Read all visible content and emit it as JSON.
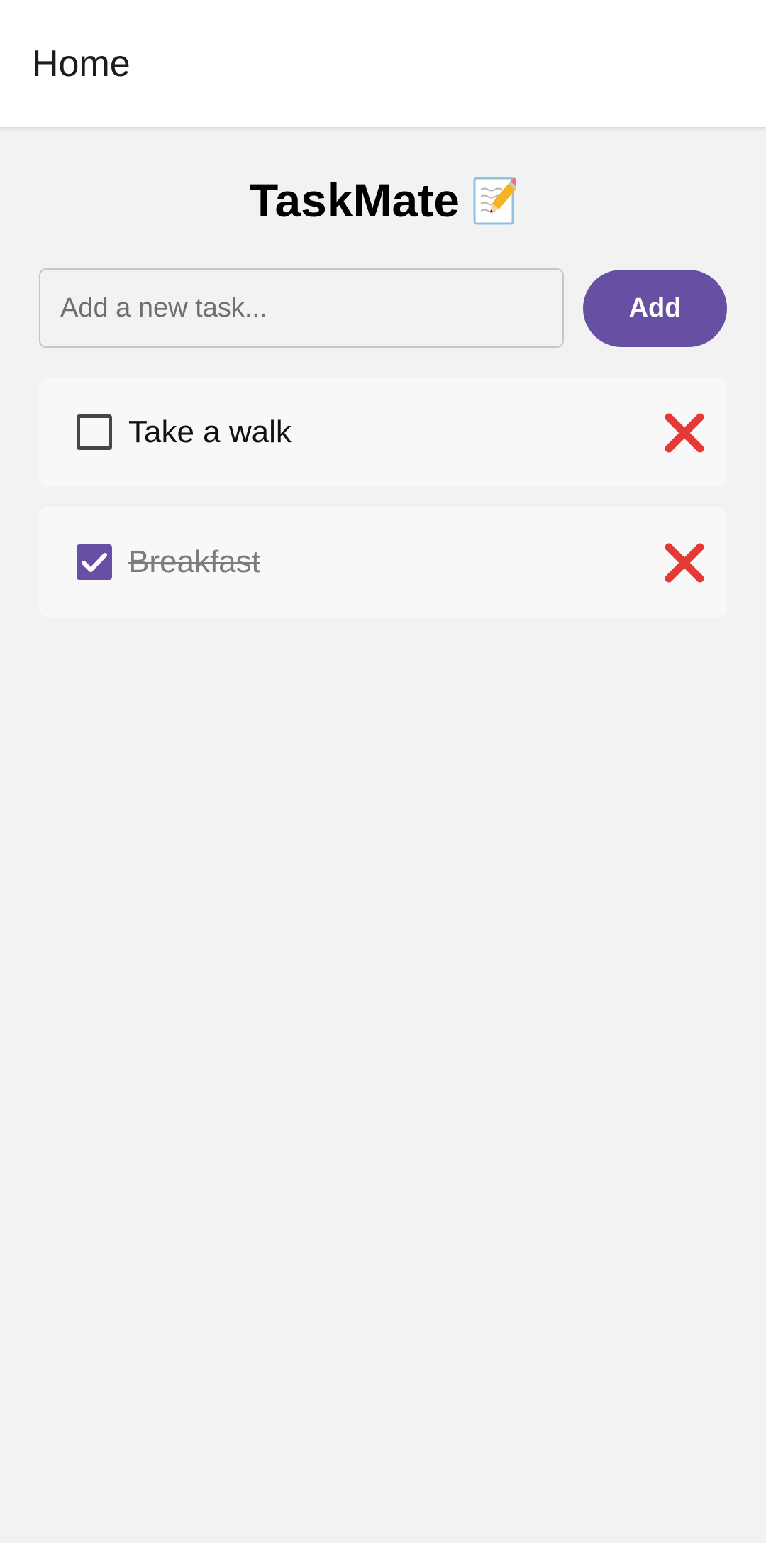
{
  "app_bar": {
    "title": "Home"
  },
  "page": {
    "title": "TaskMate",
    "title_icon": "memo-pencil-icon"
  },
  "new_task": {
    "placeholder": "Add a new task...",
    "value": "",
    "add_label": "Add"
  },
  "tasks": [
    {
      "label": "Take a walk",
      "done": false
    },
    {
      "label": "Breakfast",
      "done": true
    }
  ],
  "icons": {
    "delete": "cross-mark-icon",
    "checkbox": "checkbox-icon"
  },
  "colors": {
    "accent": "#6750a4",
    "delete": "#e53935",
    "background": "#f2f2f2",
    "card": "#f8f8f8"
  }
}
